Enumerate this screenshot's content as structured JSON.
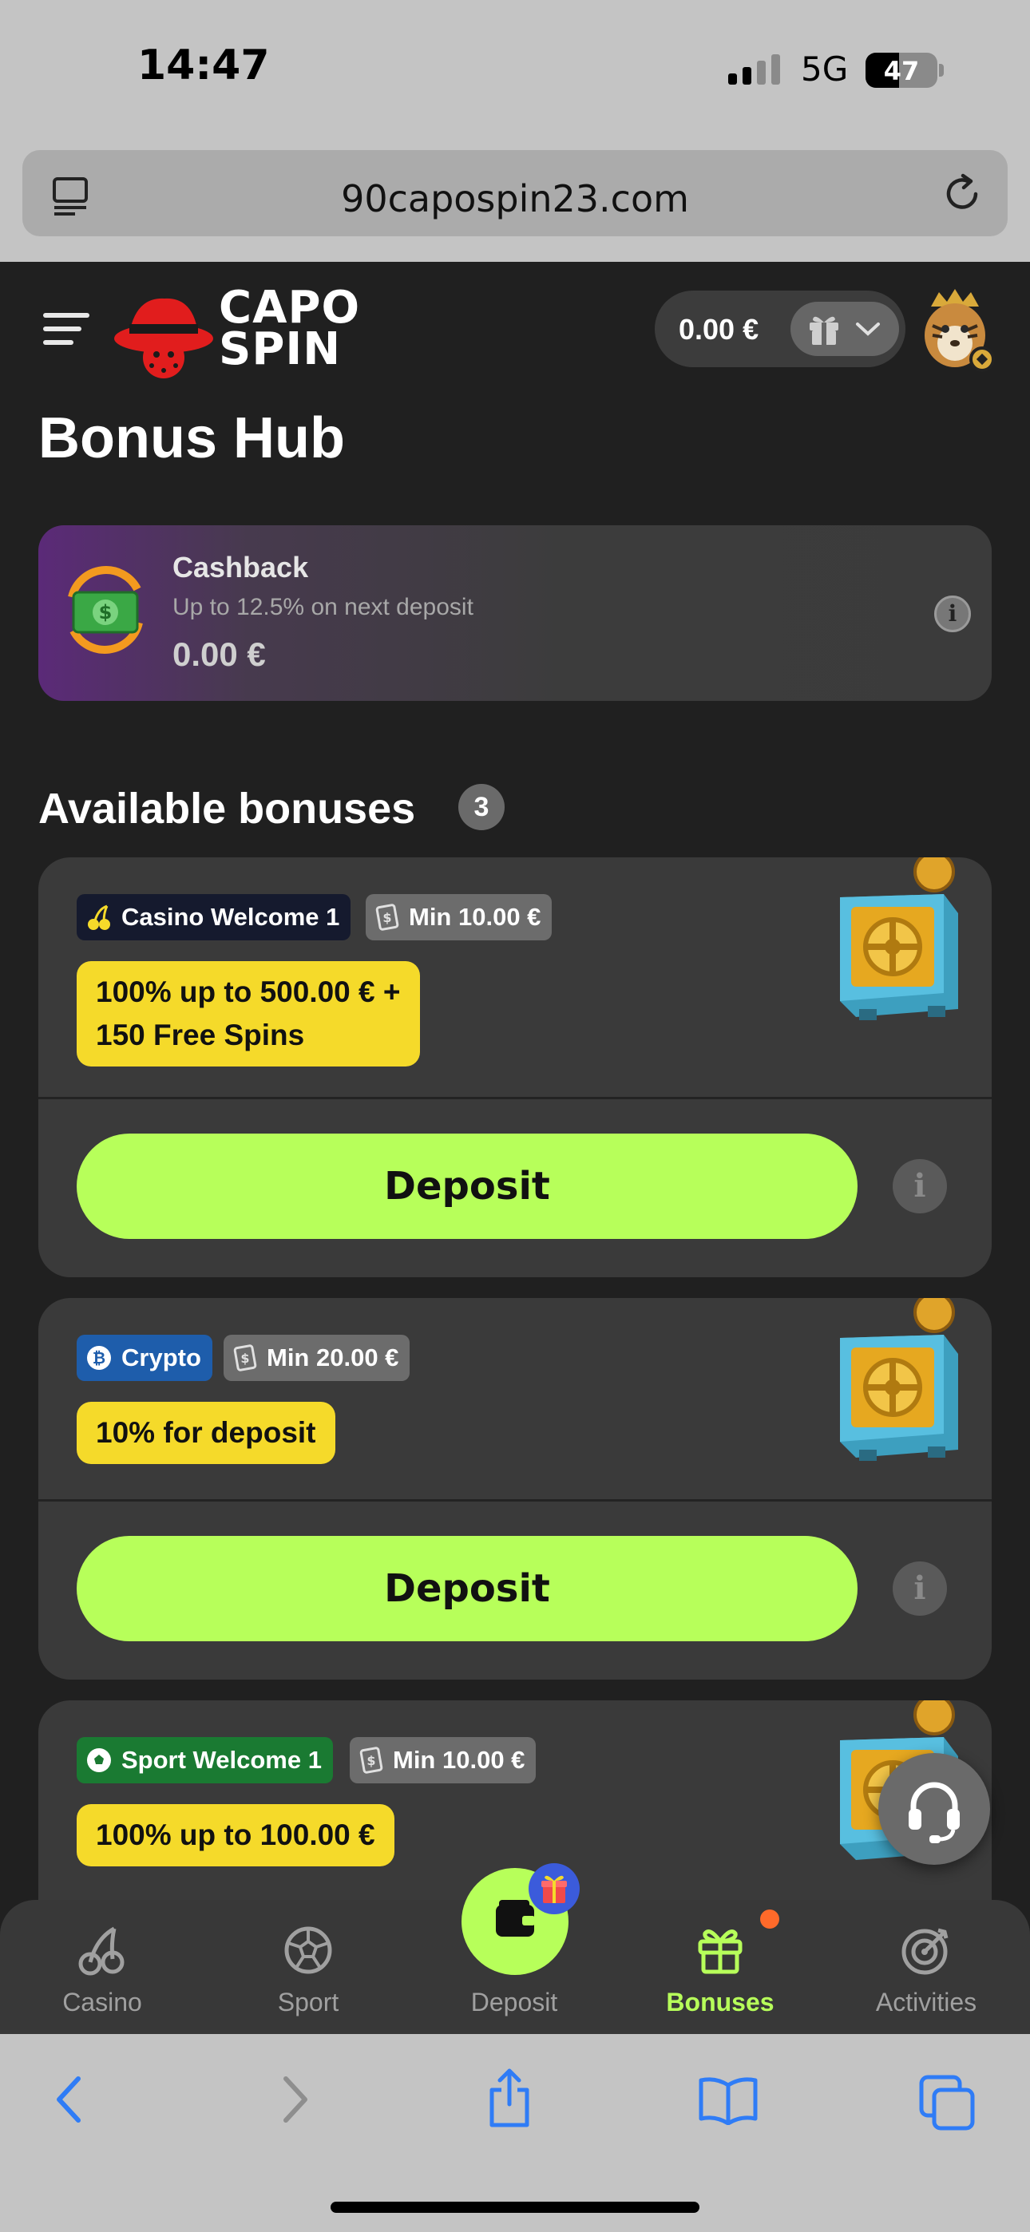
{
  "status_bar": {
    "time": "14:47",
    "network": "5G",
    "battery": "47",
    "battery_level": 0.47
  },
  "browser": {
    "url": "90capospin23.com"
  },
  "header": {
    "logo_line1": "CAPO",
    "logo_line2": "SPIN",
    "balance": "0.00 €"
  },
  "page": {
    "title": "Bonus Hub"
  },
  "cashback": {
    "title": "Cashback",
    "subtitle": "Up to 12.5% on next deposit",
    "amount": "0.00 €"
  },
  "bonuses": {
    "section_title": "Available bonuses",
    "count": "3",
    "cards": [
      {
        "category": "Casino Welcome 1",
        "min": "Min 10.00 €",
        "offer_line1": "100% up to 500.00 € +",
        "offer_line2": "150 Free Spins",
        "button": "Deposit"
      },
      {
        "category": "Crypto",
        "min": "Min 20.00 €",
        "offer_line1": "10% for deposit",
        "button": "Deposit"
      },
      {
        "category": "Sport Welcome 1",
        "min": "Min 10.00 €",
        "offer_line1": "100% up to 100.00 €"
      }
    ]
  },
  "bottom_nav": {
    "items": [
      {
        "label": "Casino",
        "icon": "cherry-icon"
      },
      {
        "label": "Sport",
        "icon": "soccer-ball-icon"
      },
      {
        "label": "Deposit",
        "icon": "wallet-icon"
      },
      {
        "label": "Bonuses",
        "icon": "gift-icon",
        "active": true
      },
      {
        "label": "Activities",
        "icon": "target-icon"
      }
    ]
  },
  "colors": {
    "accent_green": "#b7ff5a",
    "offer_yellow": "#f5da2a",
    "background": "#202020",
    "card": "#3a3a3a",
    "ios_blue": "#2f7cf6"
  }
}
